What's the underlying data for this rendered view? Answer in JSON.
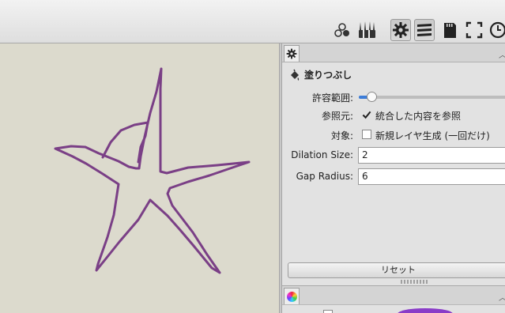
{
  "toolbar": {
    "icons": [
      "layers-circles-icon",
      "brushes-icon",
      "tool-settings-icon",
      "layers-list-icon",
      "memory-card-icon",
      "fullscreen-icon",
      "clock-icon"
    ],
    "pressed": [
      "tool-settings-icon",
      "layers-list-icon"
    ]
  },
  "colors": {
    "stroke": "#7a3f86",
    "canvas": "#dcdacd",
    "accent": "#3d7dd8"
  },
  "tool_panel": {
    "title": "塗りつぶし",
    "tolerance": {
      "label": "許容範囲:",
      "value_fraction": 0.08
    },
    "reference": {
      "label": "参照元:",
      "checked": true,
      "text": "統合した内容を参照"
    },
    "target": {
      "label": "対象:",
      "checked": false,
      "text": "新規レイヤ生成 (一回だけ)"
    },
    "dilation": {
      "label": "Dilation Size:",
      "value": "2"
    },
    "gap": {
      "label": "Gap Radius:",
      "value": "6"
    },
    "reset_label": "リセット"
  }
}
